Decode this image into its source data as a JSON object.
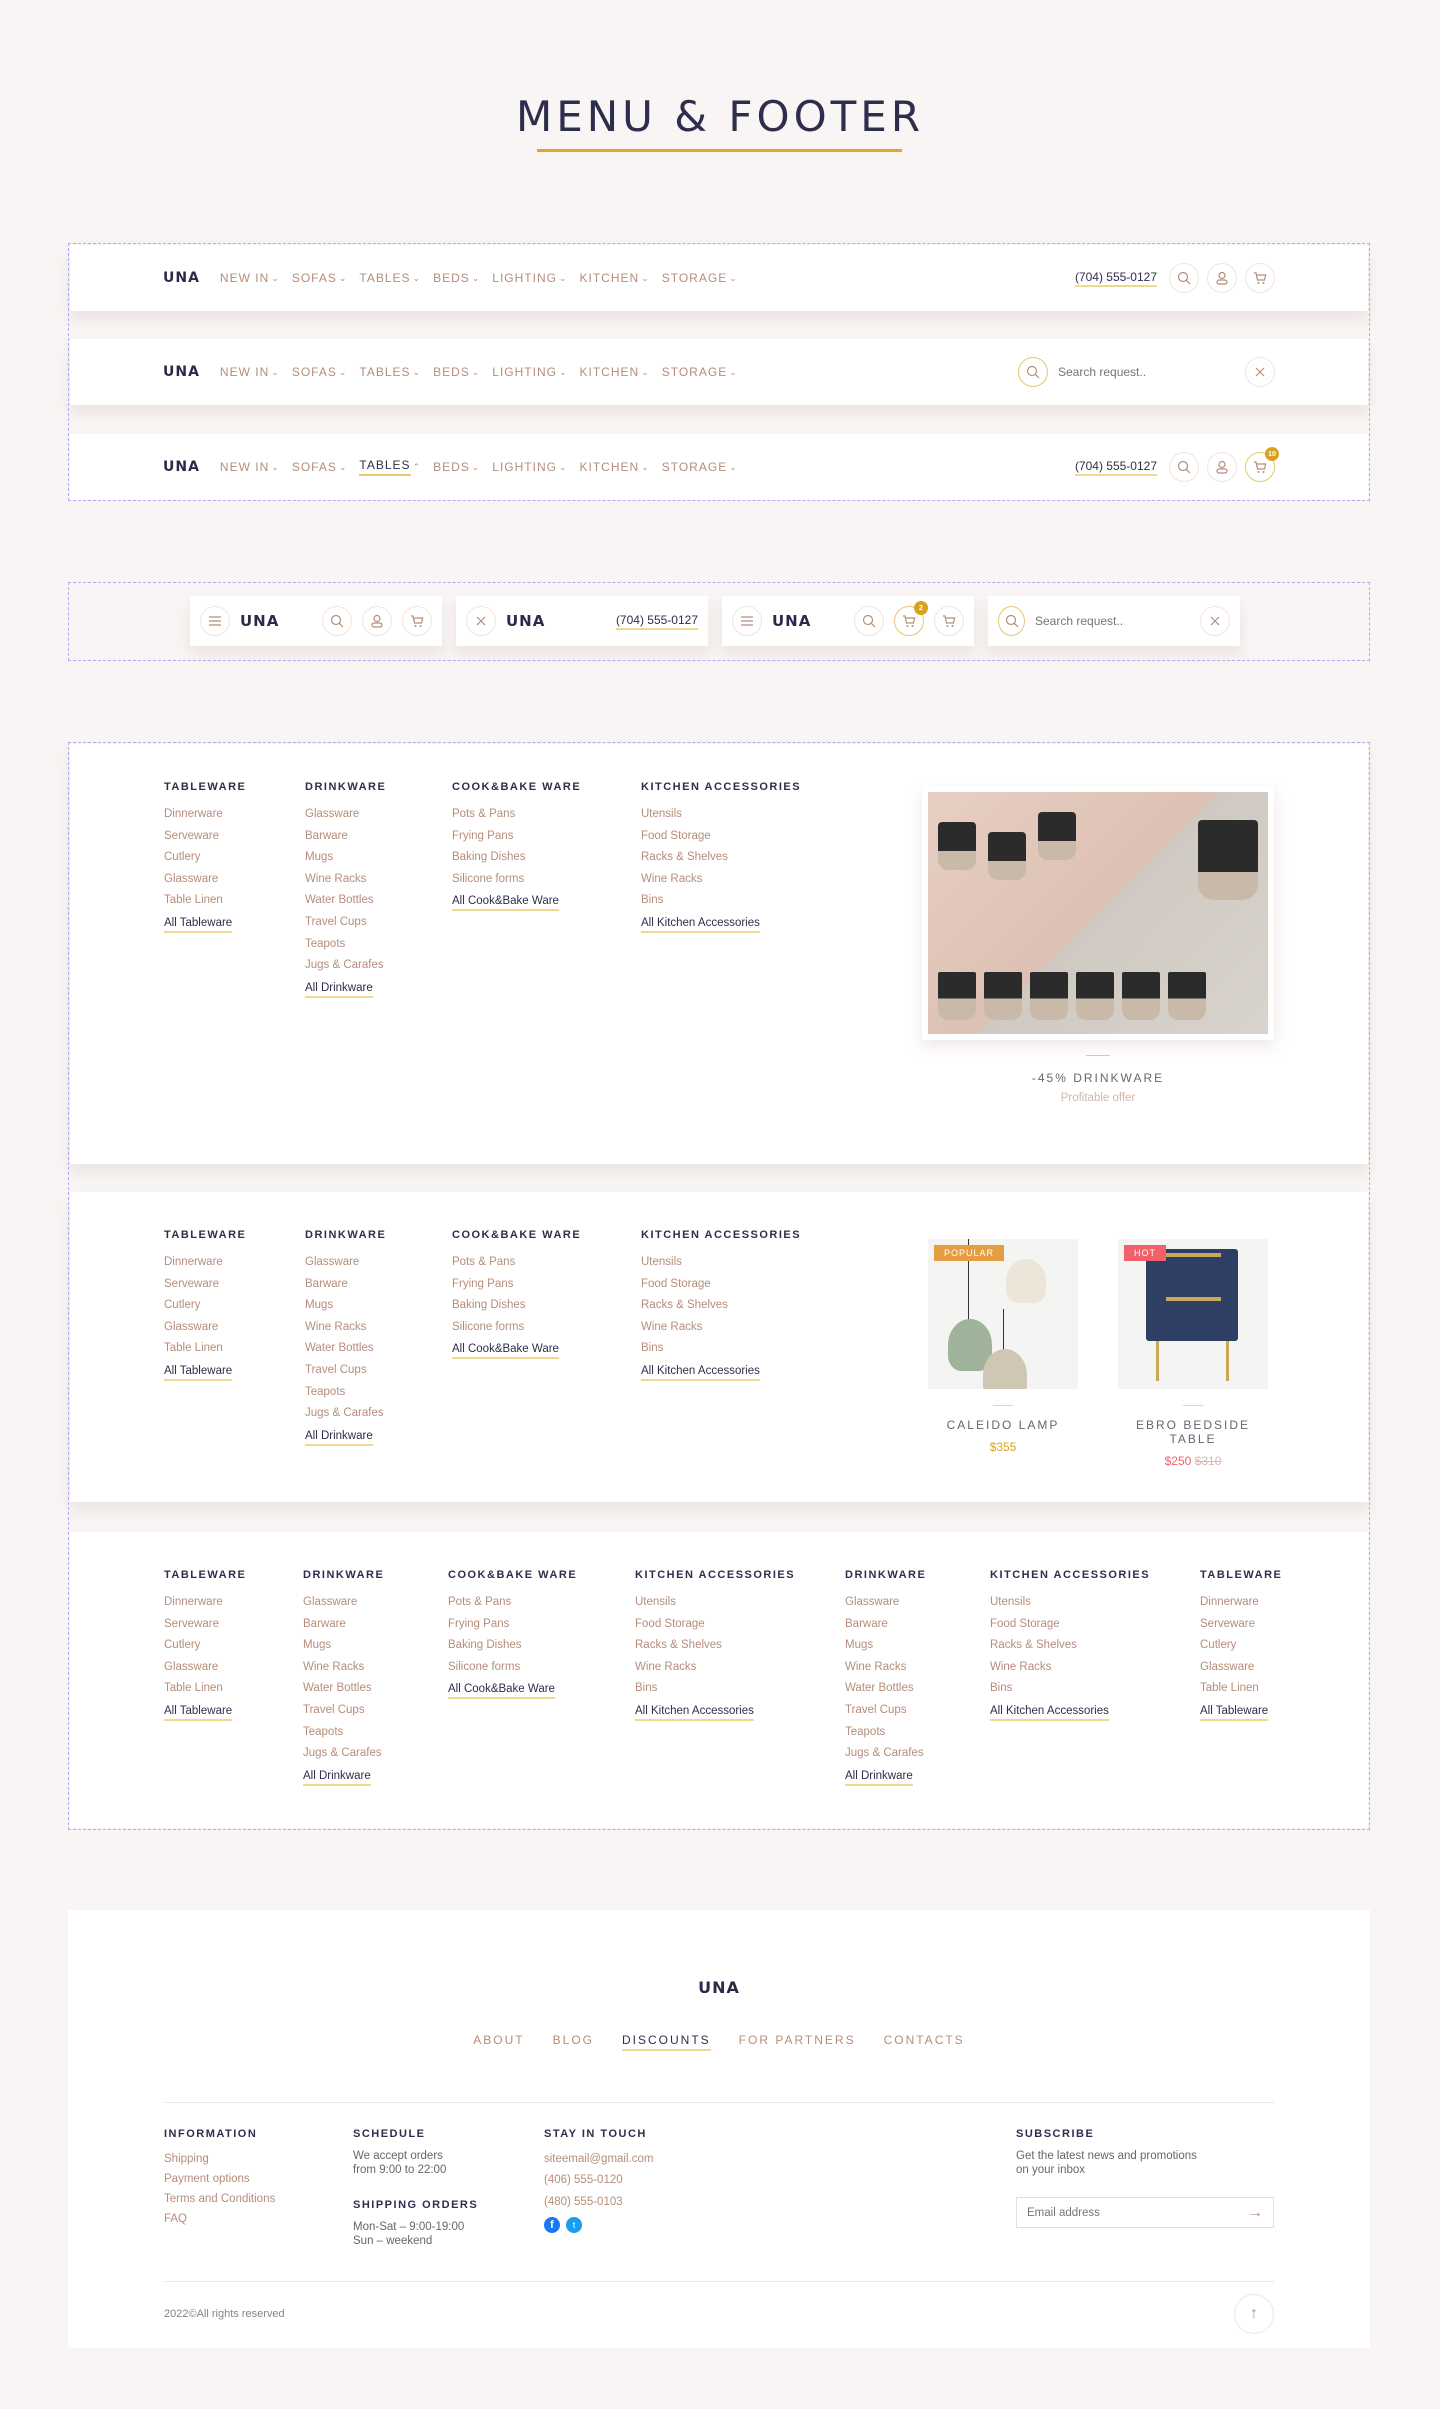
{
  "page_title": "MENU & FOOTER",
  "brand": "UNA",
  "colors": {
    "accent": "#dca826",
    "text_dark": "#2e2e4c",
    "link": "#b58d7a",
    "hot": "#f2606a",
    "popular": "#e59d42",
    "dashed_border": "#b7a8f2"
  },
  "header": {
    "nav_items": [
      "NEW IN",
      "SOFAS",
      "TABLES",
      "BEDS",
      "LIGHTING",
      "KITCHEN",
      "STORAGE"
    ],
    "phone": "(704) 555-0127",
    "search_placeholder": "Search request..",
    "active_item": "TABLES",
    "cart_count_desktop": "10",
    "cart_count_mobile": "2",
    "icons": {
      "search": "search-icon",
      "account": "user-icon",
      "cart": "cart-icon",
      "close": "close-icon",
      "menu": "hamburger-icon",
      "chevron": "chevron-down-icon"
    }
  },
  "mega_menu": {
    "columns": [
      {
        "title": "TABLEWARE",
        "items": [
          "Dinnerware",
          "Serveware",
          "Cutlery",
          "Glassware",
          "Table Linen"
        ],
        "all": "All Tableware"
      },
      {
        "title": "DRINKWARE",
        "items": [
          "Glassware",
          "Barware",
          "Mugs",
          "Wine Racks",
          "Water Bottles",
          "Travel Cups",
          "Teapots",
          "Jugs & Carafes"
        ],
        "all": "All Drinkware"
      },
      {
        "title": "COOK&BAKE WARE",
        "items": [
          "Pots & Pans",
          "Frying Pans",
          "Baking Dishes",
          "Silicone forms"
        ],
        "all": "All Cook&Bake Ware"
      },
      {
        "title": "KITCHEN ACCESSORIES",
        "items": [
          "Utensils",
          "Food Storage",
          "Racks & Shelves",
          "Wine Racks",
          "Bins"
        ],
        "all": "All Kitchen Accessories"
      }
    ],
    "promo": {
      "title": "-45% DRINKWARE",
      "subtitle": "Profitable offer"
    },
    "products": [
      {
        "name": "CALEIDO LAMP",
        "price": "$355",
        "old_price": "",
        "badge": "POPULAR"
      },
      {
        "name": "EBRO BEDSIDE TABLE",
        "price": "$250",
        "old_price": "$310",
        "badge": "HOT"
      }
    ]
  },
  "footer": {
    "nav": [
      "ABOUT",
      "BLOG",
      "DISCOUNTS",
      "FOR PARTNERS",
      "CONTACTS"
    ],
    "active_nav": "DISCOUNTS",
    "information": {
      "title": "INFORMATION",
      "links": [
        "Shipping",
        "Payment options",
        "Terms and Conditions",
        "FAQ"
      ]
    },
    "schedule": {
      "title": "SCHEDULE",
      "lines": [
        "We accept orders",
        "from 9:00 to 22:00"
      ]
    },
    "shipping": {
      "title": "SHIPPING ORDERS",
      "lines": [
        "Mon-Sat – 9:00-19:00",
        "Sun – weekend"
      ]
    },
    "contact": {
      "title": "STAY IN TOUCH",
      "email": "siteemail@gmail.com",
      "phones": [
        "(406) 555-0120",
        "(480) 555-0103"
      ]
    },
    "subscribe": {
      "title": "SUBSCRIBE",
      "text_lines": [
        "Get the latest news and promotions",
        "on your inbox"
      ],
      "placeholder": "Email address"
    },
    "copyright": "2022©All rights reserved"
  }
}
